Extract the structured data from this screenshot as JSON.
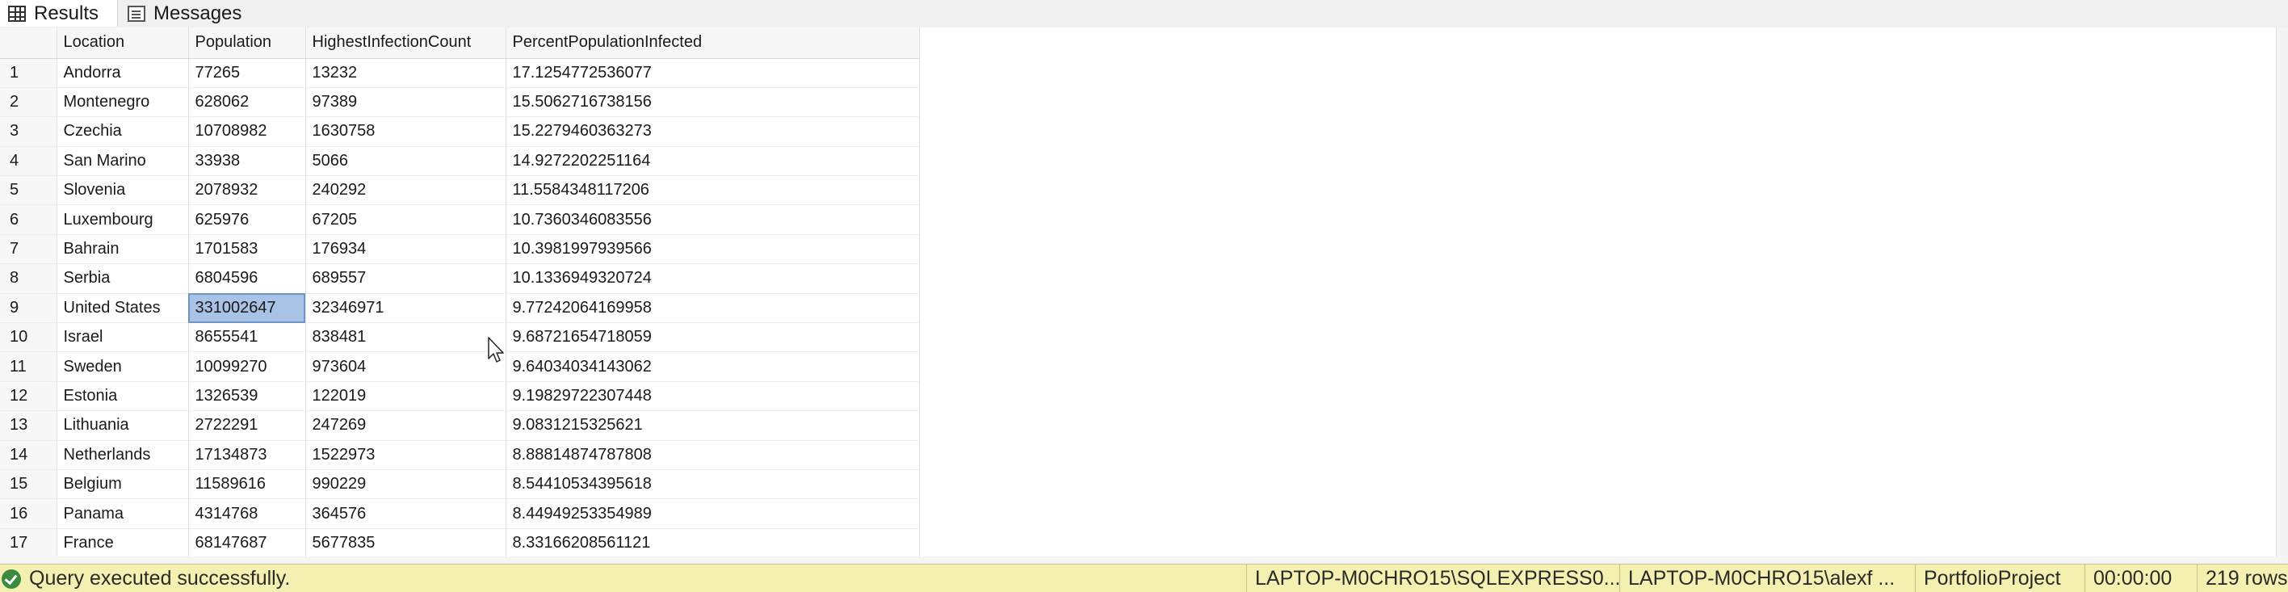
{
  "tabs": {
    "results": "Results",
    "messages": "Messages"
  },
  "grid": {
    "columns": [
      "Location",
      "Population",
      "HighestInfectionCount",
      "PercentPopulationInfected"
    ],
    "rows": [
      {
        "n": "1",
        "location": "Andorra",
        "population": "77265",
        "infections": "13232",
        "percent": "17.1254772536077"
      },
      {
        "n": "2",
        "location": "Montenegro",
        "population": "628062",
        "infections": "97389",
        "percent": "15.5062716738156"
      },
      {
        "n": "3",
        "location": "Czechia",
        "population": "10708982",
        "infections": "1630758",
        "percent": "15.2279460363273"
      },
      {
        "n": "4",
        "location": "San Marino",
        "population": "33938",
        "infections": "5066",
        "percent": "14.9272202251164"
      },
      {
        "n": "5",
        "location": "Slovenia",
        "population": "2078932",
        "infections": "240292",
        "percent": "11.5584348117206"
      },
      {
        "n": "6",
        "location": "Luxembourg",
        "population": "625976",
        "infections": "67205",
        "percent": "10.7360346083556"
      },
      {
        "n": "7",
        "location": "Bahrain",
        "population": "1701583",
        "infections": "176934",
        "percent": "10.3981997939566"
      },
      {
        "n": "8",
        "location": "Serbia",
        "population": "6804596",
        "infections": "689557",
        "percent": "10.1336949320724"
      },
      {
        "n": "9",
        "location": "United States",
        "population": "331002647",
        "infections": "32346971",
        "percent": "9.77242064169958"
      },
      {
        "n": "10",
        "location": "Israel",
        "population": "8655541",
        "infections": "838481",
        "percent": "9.68721654718059"
      },
      {
        "n": "11",
        "location": "Sweden",
        "population": "10099270",
        "infections": "973604",
        "percent": "9.64034034143062"
      },
      {
        "n": "12",
        "location": "Estonia",
        "population": "1326539",
        "infections": "122019",
        "percent": "9.19829722307448"
      },
      {
        "n": "13",
        "location": "Lithuania",
        "population": "2722291",
        "infections": "247269",
        "percent": "9.0831215325621"
      },
      {
        "n": "14",
        "location": "Netherlands",
        "population": "17134873",
        "infections": "1522973",
        "percent": "8.88814874787808"
      },
      {
        "n": "15",
        "location": "Belgium",
        "population": "11589616",
        "infections": "990229",
        "percent": "8.54410534395618"
      },
      {
        "n": "16",
        "location": "Panama",
        "population": "4314768",
        "infections": "364576",
        "percent": "8.44949253354989"
      },
      {
        "n": "17",
        "location": "France",
        "population": "68147687",
        "infections": "5677835",
        "percent": "8.33166208561121"
      }
    ],
    "selected_cell": "331002647"
  },
  "status": {
    "message": "Query executed successfully.",
    "server": "LAPTOP-M0CHRO15\\SQLEXPRESS0...",
    "user": "LAPTOP-M0CHRO15\\alexf ...",
    "database": "PortfolioProject",
    "elapsed": "00:00:00",
    "rows": "219 rows",
    "color": "#f4f1b0"
  },
  "icons": {
    "results_tab": "grid-icon",
    "messages_tab": "messages-icon",
    "status": "success-check-icon",
    "pointer": "mouse-cursor-icon"
  }
}
